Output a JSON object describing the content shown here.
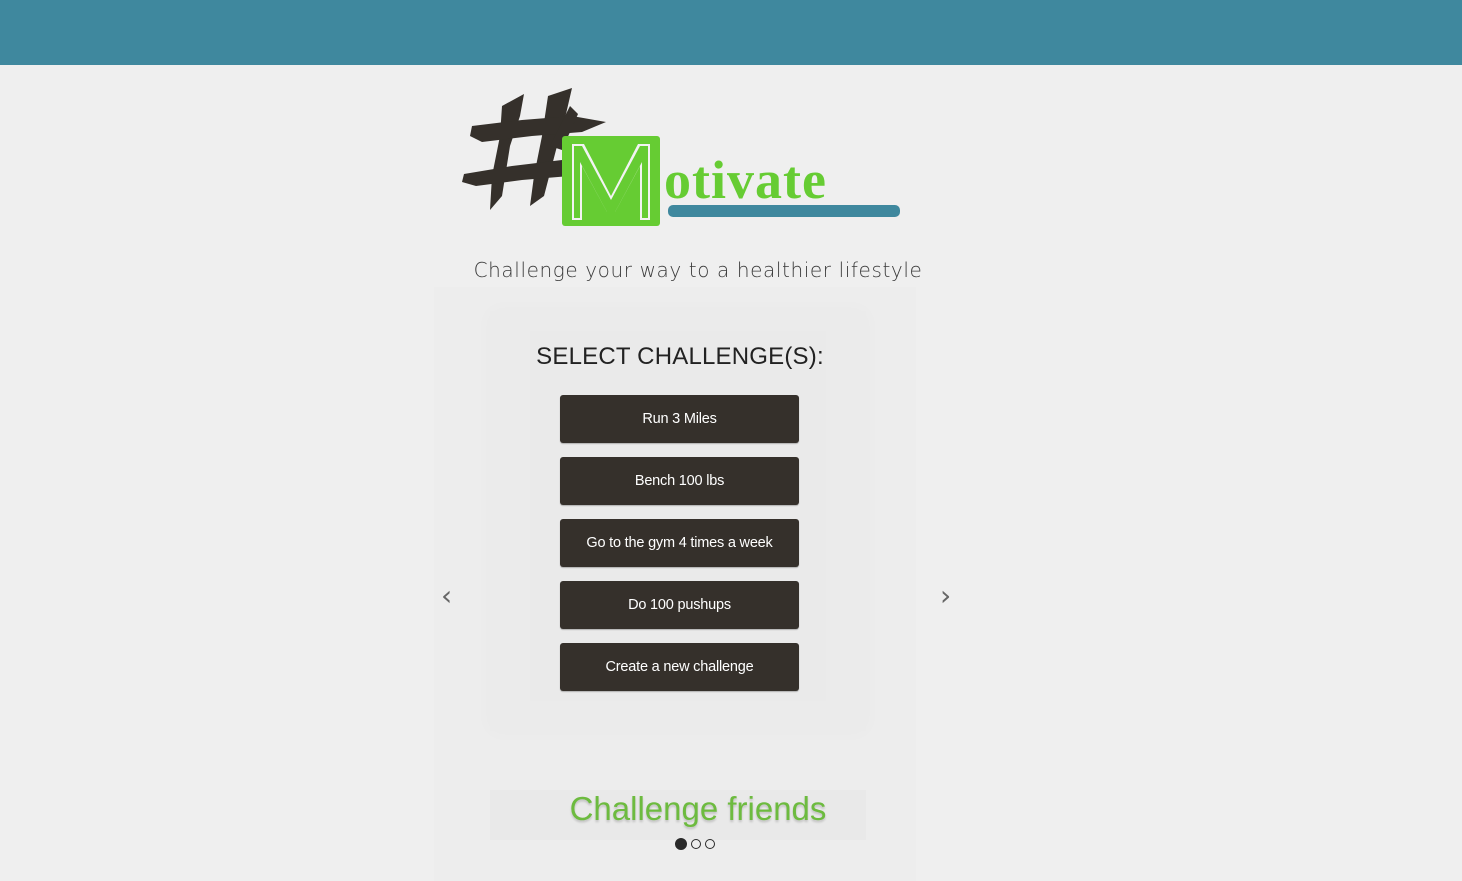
{
  "header": {
    "bar_color": "#3f889e"
  },
  "logo": {
    "text": "#Motivate",
    "hash_color": "#35302b",
    "text_color": "#66cc33",
    "underline_color": "#3f889e"
  },
  "tagline": "Challenge your way to a healthier lifestyle",
  "carousel": {
    "select_title": "SELECT CHALLENGE(S):",
    "challenges": [
      "Run 3 Miles",
      "Bench 100 lbs",
      "Go to the gym 4 times a week",
      "Do 100 pushups",
      "Create a new challenge"
    ],
    "prev_label": "‹",
    "next_label": "›",
    "next_slide_title": "Challenge friends",
    "indicator_count": 3,
    "active_indicator": 1
  }
}
